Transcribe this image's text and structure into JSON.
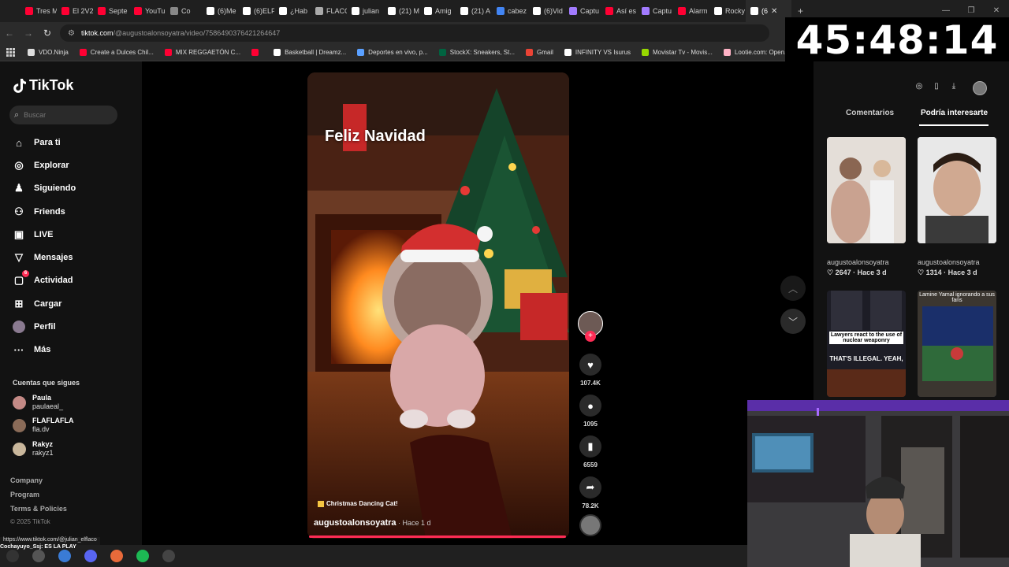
{
  "browser": {
    "tabs": [
      {
        "label": "Tres M",
        "color": "#ff0033"
      },
      {
        "label": "El 2V2",
        "color": "#ff0033"
      },
      {
        "label": "Septe",
        "color": "#ff0033"
      },
      {
        "label": "YouTu",
        "color": "#ff0033"
      },
      {
        "label": "Co",
        "color": "#888888"
      },
      {
        "label": "(6)Me",
        "color": "#ffffff"
      },
      {
        "label": "(6)ELF",
        "color": "#ffffff"
      },
      {
        "label": "¿Hab",
        "color": "#ffffff"
      },
      {
        "label": "FLACC",
        "color": "#aaaaaa"
      },
      {
        "label": "julian",
        "color": "#ffffff"
      },
      {
        "label": "(21) M",
        "color": "#ffffff"
      },
      {
        "label": "Amig",
        "color": "#ffffff"
      },
      {
        "label": "(21) A",
        "color": "#ffffff"
      },
      {
        "label": "cabez",
        "color": "#4285f4"
      },
      {
        "label": "(6)Vid",
        "color": "#ffffff"
      },
      {
        "label": "Captu",
        "color": "#a27bff"
      },
      {
        "label": "Así es",
        "color": "#ff0033"
      },
      {
        "label": "Captu",
        "color": "#a27bff"
      },
      {
        "label": "Alarm",
        "color": "#ff0033"
      },
      {
        "label": "Rocky",
        "color": "#ffffff"
      },
      {
        "label": "(6",
        "color": "#ffffff"
      }
    ],
    "new_tab": "+",
    "url_host": "tiktok.com",
    "url_path": "/@augustoalonsoyatra/video/7586490376421264647",
    "bookmarks": [
      {
        "label": "VDO.Ninja",
        "color": "#dddddd"
      },
      {
        "label": "Create a Dulces Chil...",
        "color": "#ff0033"
      },
      {
        "label": "MIX REGGAETÓN C...",
        "color": "#ff0033"
      },
      {
        "label": "",
        "color": "#ff0033"
      },
      {
        "label": "Basketball | Dreamz...",
        "color": "#ffffff"
      },
      {
        "label": "Deportes en vivo, p...",
        "color": "#5aa0ff"
      },
      {
        "label": "StockX: Sneakers, St...",
        "color": "#006340"
      },
      {
        "label": "Gmail",
        "color": "#ea4335"
      },
      {
        "label": "INFINITY VS Isurus",
        "color": "#ffffff"
      },
      {
        "label": "Movistar Tv - Movis...",
        "color": "#97d700"
      },
      {
        "label": "Lootie.com: Open...",
        "color": "#ffb3c6"
      }
    ]
  },
  "clock": "45:48:14",
  "sidebar": {
    "logo": "TikTok",
    "search_placeholder": "Buscar",
    "nav": [
      {
        "label": "Para ti",
        "icon": "home-icon"
      },
      {
        "label": "Explorar",
        "icon": "compass-icon"
      },
      {
        "label": "Siguiendo",
        "icon": "user-follow-icon"
      },
      {
        "label": "Friends",
        "icon": "friends-icon"
      },
      {
        "label": "LIVE",
        "icon": "live-icon"
      },
      {
        "label": "Mensajes",
        "icon": "send-icon"
      },
      {
        "label": "Actividad",
        "icon": "activity-icon",
        "badge": "6"
      },
      {
        "label": "Cargar",
        "icon": "upload-icon"
      },
      {
        "label": "Perfil",
        "icon": "avatar"
      },
      {
        "label": "Más",
        "icon": "more-icon"
      }
    ],
    "following_title": "Cuentas que sigues",
    "following": [
      {
        "name": "Paula",
        "handle": "paulaeal_",
        "color": "#c48a86"
      },
      {
        "name": "FLAFLAFLA",
        "handle": "fla.dv",
        "color": "#8a6b58"
      },
      {
        "name": "Rakyz",
        "handle": "rakyz1",
        "color": "#c9b79c"
      }
    ],
    "footer": [
      "Company",
      "Program",
      "Terms & Policies"
    ],
    "copyright": "© 2025 TikTok"
  },
  "video": {
    "greeting": "Feliz Navidad",
    "caption": "Christmas Dancing Cat!",
    "author": "augustoalonsoyatra",
    "ago": " · Hace 1 d",
    "likes": "107.4K",
    "comments": "1095",
    "saves": "6559",
    "shares": "78.2K"
  },
  "right_panel": {
    "tabs": [
      "Comentarios",
      "Podría interesarte"
    ],
    "thumbs": [
      {
        "user": "augustoalonsoyatra",
        "likes": "2647",
        "ago": "Hace 3 d"
      },
      {
        "user": "augustoalonsoyatra",
        "likes": "1314",
        "ago": "Hace 3 d"
      },
      {
        "overlay": "Lawyers react to the use of nuclear weaponry",
        "overlay2": "THAT'S ILLEGAL. YEAH,"
      },
      {
        "overlay": "Lamine Yamal ignorando a sus fans"
      }
    ]
  },
  "status": {
    "hover_url": "https://www.tiktok.com/@julian_elflaco",
    "chat_user": "Cochayuyo_Ssj",
    "chat_text": ": ES LA PLAY"
  }
}
